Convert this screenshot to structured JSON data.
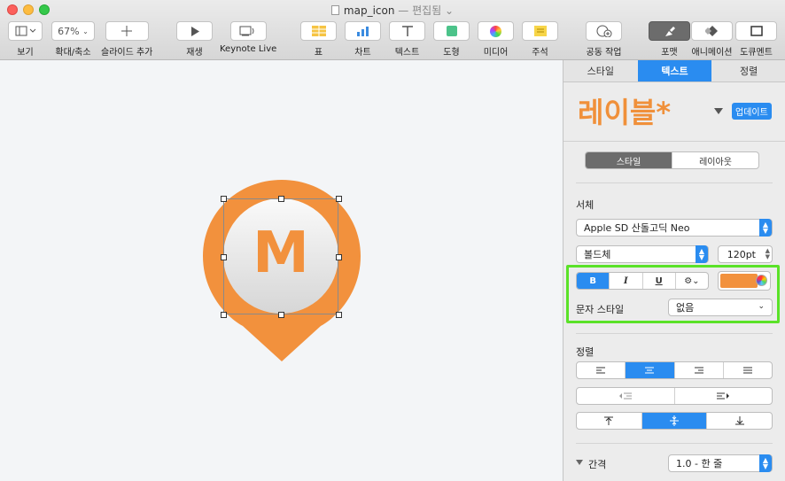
{
  "window": {
    "title": "map_icon",
    "status": "— 편집됨 ⌄"
  },
  "toolbar": {
    "view": {
      "label": "보기",
      "icon": "sidebar-icon"
    },
    "zoom": {
      "label": "확대/축소",
      "value": "67%"
    },
    "add_slide": {
      "label": "슬라이드 추가",
      "icon": "plus-icon"
    },
    "play": {
      "label": "재생",
      "icon": "play-icon"
    },
    "keynote_live": {
      "label": "Keynote Live",
      "icon": "keynote-live-icon"
    },
    "table": {
      "label": "표",
      "icon": "table-icon"
    },
    "chart": {
      "label": "차트",
      "icon": "chart-icon"
    },
    "text": {
      "label": "텍스트",
      "icon": "text-icon"
    },
    "shape": {
      "label": "도형",
      "icon": "shape-icon"
    },
    "media": {
      "label": "미디어",
      "icon": "media-icon"
    },
    "comment": {
      "label": "주석",
      "icon": "comment-icon"
    },
    "collaborate": {
      "label": "공동 작업",
      "icon": "collaborate-icon"
    },
    "format": {
      "label": "포맷",
      "icon": "format-brush-icon"
    },
    "animate": {
      "label": "애니메이션",
      "icon": "animate-icon"
    },
    "document": {
      "label": "도큐멘트",
      "icon": "document-icon"
    }
  },
  "slide": {
    "pin_letter": "M",
    "pin_color": "#f2913d"
  },
  "inspector": {
    "tabs": [
      "스타일",
      "텍스트",
      "정렬"
    ],
    "active_tab": "텍스트",
    "preview_text": "레이블*",
    "update_label": "업데이트",
    "subtabs": [
      "스타일",
      "레이아웃"
    ],
    "font_section": "서체",
    "font_family": "Apple SD 산돌고딕 Neo",
    "font_weight": "볼드체",
    "font_size": "120pt",
    "bold": "B",
    "italic": "I",
    "underline": "U",
    "gear": "⚙⌄",
    "text_color": "#f2913d",
    "char_style_label": "문자 스타일",
    "char_style_value": "없음",
    "align_section": "정렬",
    "spacing_label": "간격",
    "spacing_value": "1.0 - 한 줄"
  }
}
